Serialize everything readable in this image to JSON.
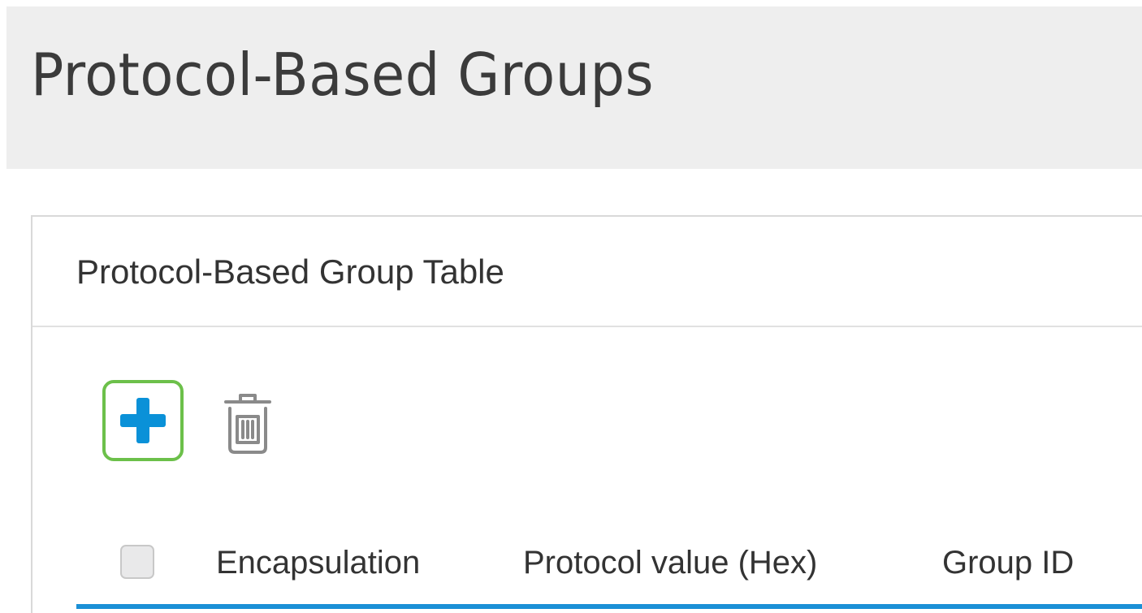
{
  "page": {
    "title": "Protocol-Based Groups"
  },
  "panel": {
    "title": "Protocol-Based Group Table"
  },
  "toolbar": {
    "add_icon": "plus-icon",
    "delete_icon": "trash-icon"
  },
  "table": {
    "columns": [
      "Encapsulation",
      "Protocol value (Hex)",
      "Group ID"
    ],
    "select_all_checked": false
  },
  "colors": {
    "accent": "#1b90d6",
    "add_icon": "#0a91d8",
    "focus_outline": "#6cc04a",
    "header_band": "#eeeeee"
  }
}
